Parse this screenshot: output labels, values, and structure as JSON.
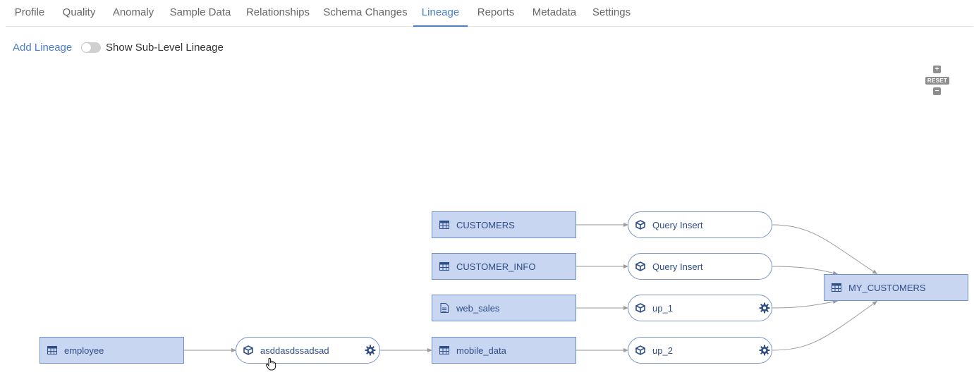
{
  "tabs": [
    {
      "label": "Profile"
    },
    {
      "label": "Quality"
    },
    {
      "label": "Anomaly"
    },
    {
      "label": "Sample Data"
    },
    {
      "label": "Relationships"
    },
    {
      "label": "Schema Changes"
    },
    {
      "label": "Lineage",
      "active": true
    },
    {
      "label": "Reports"
    },
    {
      "label": "Metadata"
    },
    {
      "label": "Settings"
    }
  ],
  "toolbar": {
    "add_lineage_label": "Add Lineage",
    "sub_level_toggle_label": "Show Sub-Level Lineage",
    "sub_level_toggle_on": false
  },
  "zoom_controls": {
    "zoom_in_label": "+",
    "reset_label": "RESET",
    "zoom_out_label": "−"
  },
  "lineage": {
    "nodes": {
      "customers": {
        "label": "CUSTOMERS",
        "kind": "table",
        "icon": "table-icon"
      },
      "customer_info": {
        "label": "CUSTOMER_INFO",
        "kind": "table",
        "icon": "table-icon"
      },
      "web_sales": {
        "label": "web_sales",
        "kind": "file",
        "icon": "file-icon"
      },
      "mobile_data": {
        "label": "mobile_data",
        "kind": "table",
        "icon": "table-icon"
      },
      "employee": {
        "label": "employee",
        "kind": "table",
        "icon": "table-icon"
      },
      "asddasdssadsad": {
        "label": "asddasdssadsad",
        "kind": "process",
        "icon": "cube-icon",
        "has_settings": true
      },
      "query_insert_1": {
        "label": "Query Insert",
        "kind": "process",
        "icon": "cube-icon",
        "has_settings": false
      },
      "query_insert_2": {
        "label": "Query Insert",
        "kind": "process",
        "icon": "cube-icon",
        "has_settings": false
      },
      "up_1": {
        "label": "up_1",
        "kind": "process",
        "icon": "cube-icon",
        "has_settings": true
      },
      "up_2": {
        "label": "up_2",
        "kind": "process",
        "icon": "cube-icon",
        "has_settings": true
      },
      "my_customers": {
        "label": "MY_CUSTOMERS",
        "kind": "table",
        "icon": "table-icon"
      }
    },
    "edges": [
      [
        "employee",
        "asddasdssadsad"
      ],
      [
        "asddasdssadsad",
        "mobile_data"
      ],
      [
        "customers",
        "query_insert_1"
      ],
      [
        "customer_info",
        "query_insert_2"
      ],
      [
        "web_sales",
        "up_1"
      ],
      [
        "mobile_data",
        "up_2"
      ],
      [
        "query_insert_1",
        "my_customers"
      ],
      [
        "query_insert_2",
        "my_customers"
      ],
      [
        "up_1",
        "my_customers"
      ],
      [
        "up_2",
        "my_customers"
      ]
    ],
    "colors": {
      "table_fill": "#c8d6f1",
      "table_border": "#6f8fca",
      "label": "#2f4d87",
      "edge": "#9a9a9a",
      "accent": "#4a7fc7"
    }
  }
}
